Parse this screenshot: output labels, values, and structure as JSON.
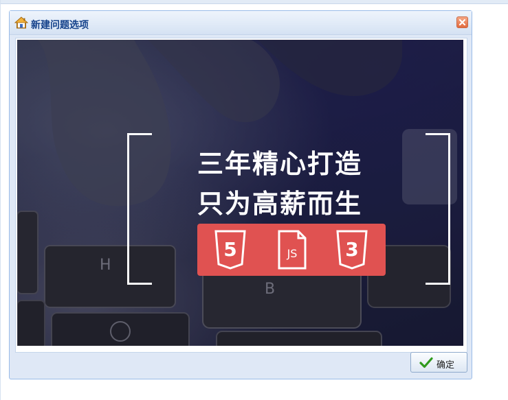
{
  "dialog": {
    "title": "新建问题选项",
    "icons": {
      "title": "home-icon",
      "close": "close-icon",
      "confirm": "check-icon"
    },
    "confirm_label": "确定"
  },
  "banner": {
    "headline_line1": "三年精心打造",
    "headline_line2": "只为高薪而生",
    "tech_badges": [
      "5",
      "JS",
      "3"
    ],
    "accent_color": "#e05251"
  }
}
